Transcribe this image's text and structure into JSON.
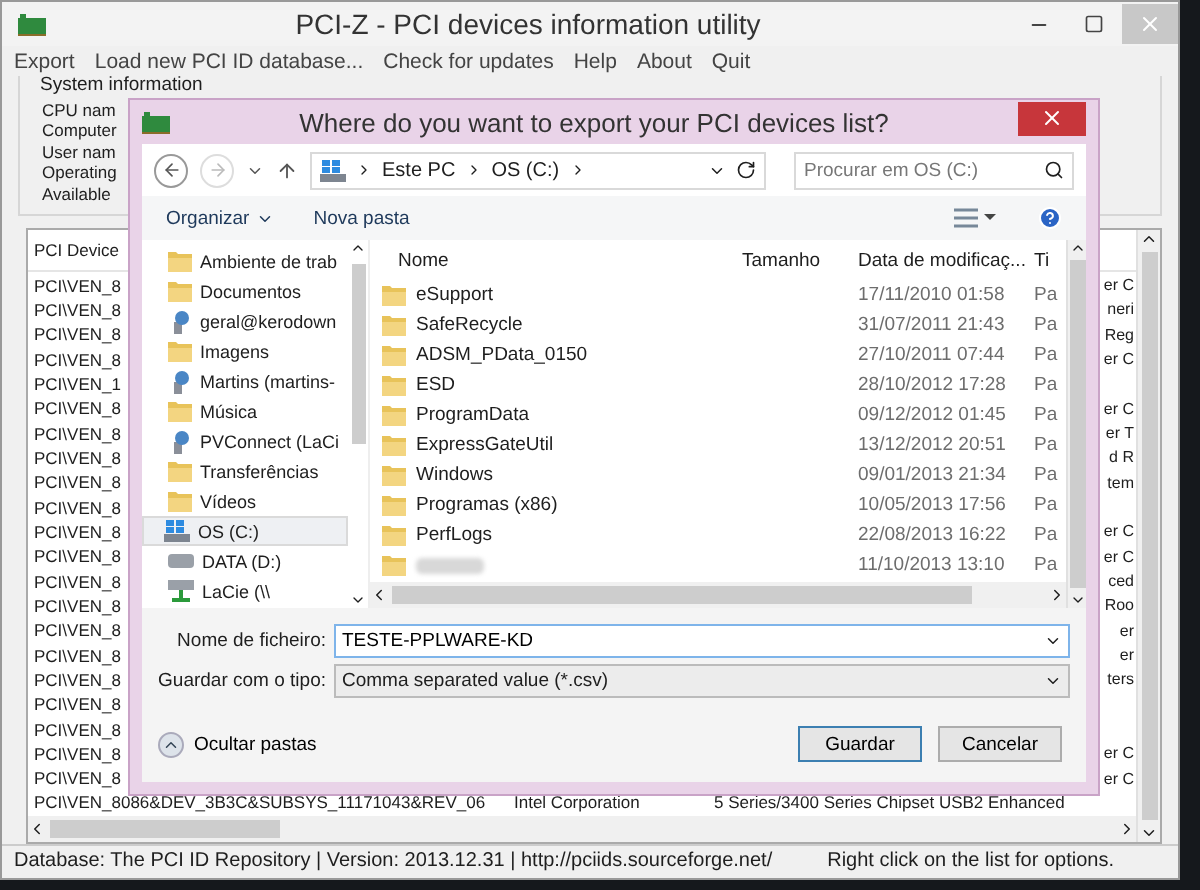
{
  "window": {
    "title": "PCI-Z - PCI devices information utility"
  },
  "menu": [
    "Export",
    "Load new PCI ID database...",
    "Check for updates",
    "Help",
    "About",
    "Quit"
  ],
  "system_information": {
    "title": "System information",
    "labels": [
      "CPU nam",
      "Computer",
      "User nam",
      "Operating",
      "Available"
    ]
  },
  "device_list": {
    "header": "PCI Device",
    "rows": [
      {
        "kind": "covered",
        "id": "PCI\\VEN_8",
        "tail": "er C"
      },
      {
        "kind": "covered",
        "id": "PCI\\VEN_8",
        "tail": "neri"
      },
      {
        "kind": "covered",
        "id": "PCI\\VEN_8",
        "tail": "Reg"
      },
      {
        "kind": "covered",
        "id": "PCI\\VEN_8",
        "tail": "er C"
      },
      {
        "kind": "covered",
        "id": "PCI\\VEN_1"
      },
      {
        "kind": "covered",
        "id": "PCI\\VEN_8",
        "tail": "er C"
      },
      {
        "kind": "covered",
        "id": "PCI\\VEN_8",
        "tail": "er T"
      },
      {
        "kind": "covered",
        "id": "PCI\\VEN_8",
        "tail": "d R"
      },
      {
        "kind": "covered",
        "id": "PCI\\VEN_8",
        "tail": "tem"
      },
      {
        "kind": "covered",
        "id": "PCI\\VEN_8"
      },
      {
        "kind": "covered",
        "id": "PCI\\VEN_8",
        "tail": "er C"
      },
      {
        "kind": "covered",
        "id": "PCI\\VEN_8",
        "tail": "er C"
      },
      {
        "kind": "covered",
        "id": "PCI\\VEN_8",
        "tail": "ced"
      },
      {
        "kind": "covered",
        "id": "PCI\\VEN_8",
        "tail": "Roo"
      },
      {
        "kind": "covered",
        "id": "PCI\\VEN_8",
        "tail": "er"
      },
      {
        "kind": "covered",
        "id": "PCI\\VEN_8",
        "tail": "er"
      },
      {
        "kind": "covered",
        "id": "PCI\\VEN_8",
        "tail": "ters"
      },
      {
        "kind": "covered",
        "id": "PCI\\VEN_8"
      },
      {
        "kind": "covered",
        "id": "PCI\\VEN_8"
      },
      {
        "kind": "covered",
        "id": "PCI\\VEN_8",
        "tail": "er C"
      },
      {
        "kind": "covered",
        "id": "PCI\\VEN_8",
        "tail": "er C"
      },
      {
        "kind": "full",
        "id": "PCI\\VEN_8086&DEV_3B3C&SUBSYS_11171043&REV_06",
        "vendor": "Intel Corporation",
        "tail": "5 Series/3400 Series Chipset USB2 Enhanced"
      }
    ]
  },
  "status_bar": {
    "left": "Database: The PCI ID Repository | Version: 2013.12.31 | http://pciids.sourceforge.net/",
    "right": "Right click on the list for options."
  },
  "dialog": {
    "title": "Where do you want to export your PCI devices list?",
    "breadcrumb": [
      "Este PC",
      "OS (C:)"
    ],
    "search": {
      "placeholder": "Procurar em OS (C:)"
    },
    "toolbar": [
      "Organizar",
      "Nova pasta"
    ],
    "nav_items": [
      {
        "label": "Ambiente de trab",
        "kind": "folder",
        "selected": false
      },
      {
        "label": "Documentos",
        "kind": "folder",
        "selected": false
      },
      {
        "label": "geral@kerodown",
        "kind": "network",
        "selected": false
      },
      {
        "label": "Imagens",
        "kind": "folder",
        "selected": false
      },
      {
        "label": "Martins (martins-",
        "kind": "network",
        "selected": false
      },
      {
        "label": "Música",
        "kind": "folder",
        "selected": false
      },
      {
        "label": "PVConnect (LaCi",
        "kind": "network",
        "selected": false
      },
      {
        "label": "Transferências",
        "kind": "folder",
        "selected": false
      },
      {
        "label": "Vídeos",
        "kind": "folder",
        "selected": false
      },
      {
        "label": "OS (C:)",
        "kind": "drive",
        "selected": true
      },
      {
        "label": "DATA (D:)",
        "kind": "disk",
        "selected": false
      },
      {
        "label": "LaCie (\\\\",
        "kind": "netdrive",
        "selected": false
      }
    ],
    "columns": [
      "Nome",
      "Tamanho",
      "Data de modificaç...",
      "Ti"
    ],
    "files": [
      {
        "name": "eSupport",
        "date": "17/11/2010 01:58",
        "type": "Pa"
      },
      {
        "name": "SafeRecycle",
        "date": "31/07/2011 21:43",
        "type": "Pa"
      },
      {
        "name": "ADSM_PData_0150",
        "date": "27/10/2011 07:44",
        "type": "Pa"
      },
      {
        "name": "ESD",
        "date": "28/10/2012 17:28",
        "type": "Pa"
      },
      {
        "name": "ProgramData",
        "date": "09/12/2012 01:45",
        "type": "Pa"
      },
      {
        "name": "ExpressGateUtil",
        "date": "13/12/2012 20:51",
        "type": "Pa"
      },
      {
        "name": "Windows",
        "date": "09/01/2013 21:34",
        "type": "Pa"
      },
      {
        "name": "Programas (x86)",
        "date": "10/05/2013 17:56",
        "type": "Pa"
      },
      {
        "name": "PerfLogs",
        "date": "22/08/2013 16:22",
        "type": "Pa"
      },
      {
        "date": "11/10/2013 13:10",
        "type": "Pa"
      }
    ],
    "filename": {
      "label": "Nome de ficheiro:",
      "value": "TESTE-PPLWARE-KD"
    },
    "filetype": {
      "label": "Guardar com o tipo:",
      "value": "Comma separated value (*.csv)"
    },
    "hide_folders": "Ocultar pastas",
    "buttons": [
      "Guardar",
      "Cancelar"
    ]
  }
}
